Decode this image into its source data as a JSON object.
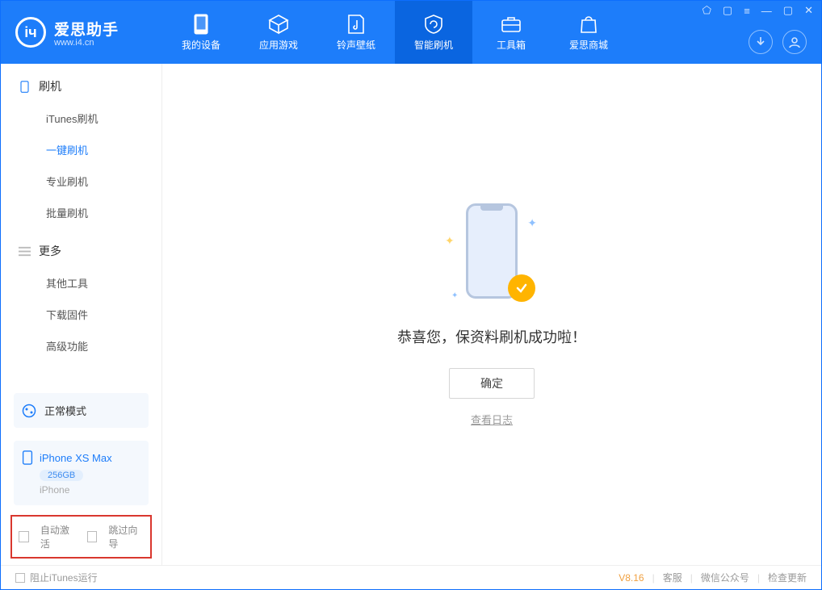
{
  "app": {
    "name": "爱思助手",
    "url": "www.i4.cn"
  },
  "nav": [
    {
      "id": "device",
      "label": "我的设备"
    },
    {
      "id": "apps",
      "label": "应用游戏"
    },
    {
      "id": "ring",
      "label": "铃声壁纸"
    },
    {
      "id": "flash",
      "label": "智能刷机",
      "active": true
    },
    {
      "id": "toolbox",
      "label": "工具箱"
    },
    {
      "id": "store",
      "label": "爱思商城"
    }
  ],
  "sidebar": {
    "group_flash": "刷机",
    "items_flash": [
      {
        "label": "iTunes刷机"
      },
      {
        "label": "一键刷机",
        "active": true
      },
      {
        "label": "专业刷机"
      },
      {
        "label": "批量刷机"
      }
    ],
    "group_more": "更多",
    "items_more": [
      {
        "label": "其他工具"
      },
      {
        "label": "下载固件"
      },
      {
        "label": "高级功能"
      }
    ]
  },
  "mode": {
    "label": "正常模式"
  },
  "device": {
    "name": "iPhone XS Max",
    "storage": "256GB",
    "type": "iPhone"
  },
  "checkboxes": {
    "auto_activate": "自动激活",
    "skip_guide": "跳过向导"
  },
  "main": {
    "success_msg": "恭喜您，保资料刷机成功啦！",
    "confirm": "确定",
    "view_log": "查看日志"
  },
  "status": {
    "block_itunes": "阻止iTunes运行",
    "version": "V8.16",
    "links": [
      "客服",
      "微信公众号",
      "检查更新"
    ]
  }
}
